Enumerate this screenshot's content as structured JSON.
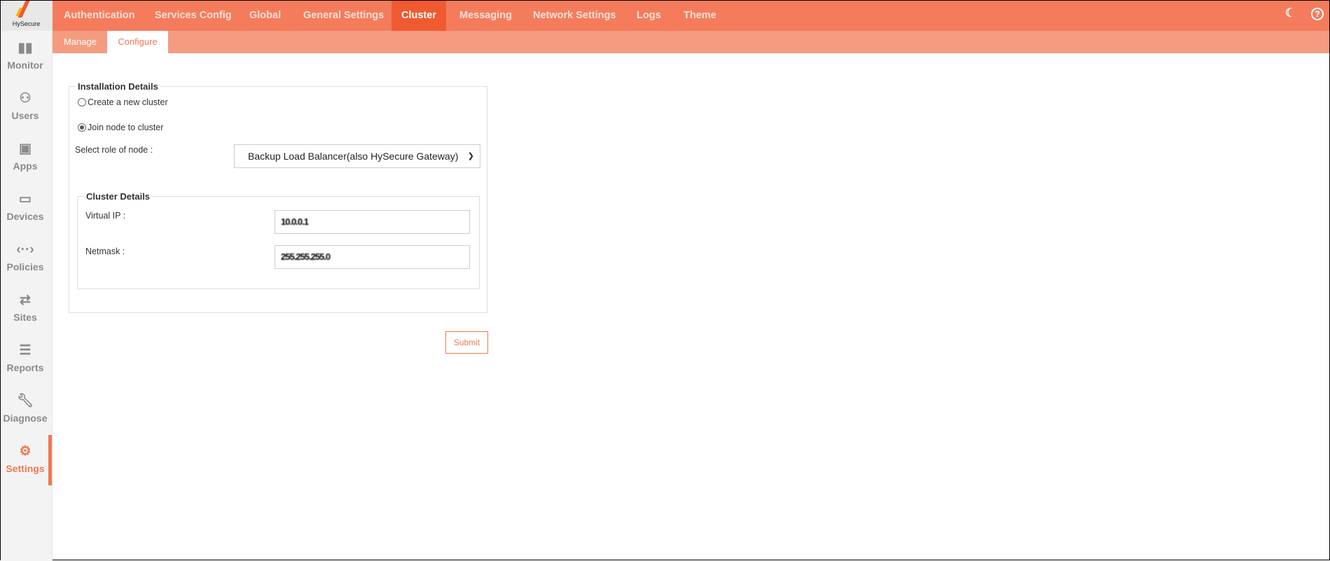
{
  "brand": {
    "name": "HySecure"
  },
  "sidebar": {
    "items": [
      {
        "label": "Monitor",
        "icon": "bar-chart-icon"
      },
      {
        "label": "Users",
        "icon": "user-icon"
      },
      {
        "label": "Apps",
        "icon": "apps-icon"
      },
      {
        "label": "Devices",
        "icon": "laptop-icon"
      },
      {
        "label": "Policies",
        "icon": "code-icon"
      },
      {
        "label": "Sites",
        "icon": "arrows-icon"
      },
      {
        "label": "Reports",
        "icon": "document-icon"
      },
      {
        "label": "Diagnose",
        "icon": "wrench-icon"
      },
      {
        "label": "Settings",
        "icon": "gear-icon",
        "active": true
      }
    ]
  },
  "topnav": {
    "tabs": [
      "Authentication",
      "Services Config",
      "Global",
      "General Settings",
      "Cluster",
      "Messaging",
      "Network Settings",
      "Logs",
      "Theme"
    ],
    "active": "Cluster"
  },
  "subnav": {
    "tabs": [
      "Manage",
      "Configure"
    ],
    "active": "Configure"
  },
  "form": {
    "installation_legend": "Installation Details",
    "radio_create": "Create a new cluster",
    "radio_join": "Join node to cluster",
    "role_label": "Select role of node :",
    "role_value": "Backup Load Balancer(also HySecure Gateway)",
    "cluster_legend": "Cluster Details",
    "vip_label": "Virtual IP :",
    "vip_value": "10.0.0.1",
    "netmask_label": "Netmask :",
    "netmask_value": "255.255.255.0",
    "submit": "Submit"
  },
  "colors": {
    "accent": "#f47c5c",
    "active": "#f05a30",
    "subbar": "#f59b80"
  }
}
